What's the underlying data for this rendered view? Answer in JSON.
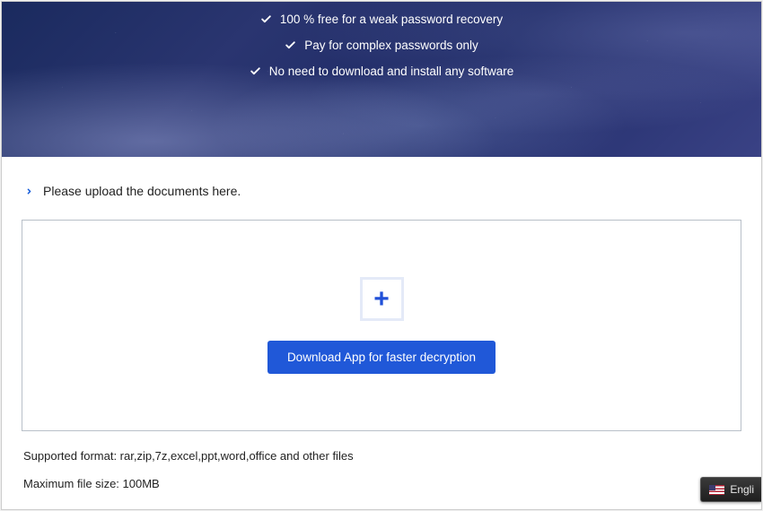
{
  "hero": {
    "features": [
      "100 % free for a weak password recovery",
      "Pay for complex passwords only",
      "No need to download and install any software"
    ]
  },
  "upload": {
    "heading": "Please upload the documents here.",
    "download_app_label": "Download App for faster decryption"
  },
  "info": {
    "formats": "Supported format: rar,zip,7z,excel,ppt,word,office and other files",
    "maxsize": "Maximum file size: 100MB"
  },
  "language": {
    "label": "Engli"
  }
}
